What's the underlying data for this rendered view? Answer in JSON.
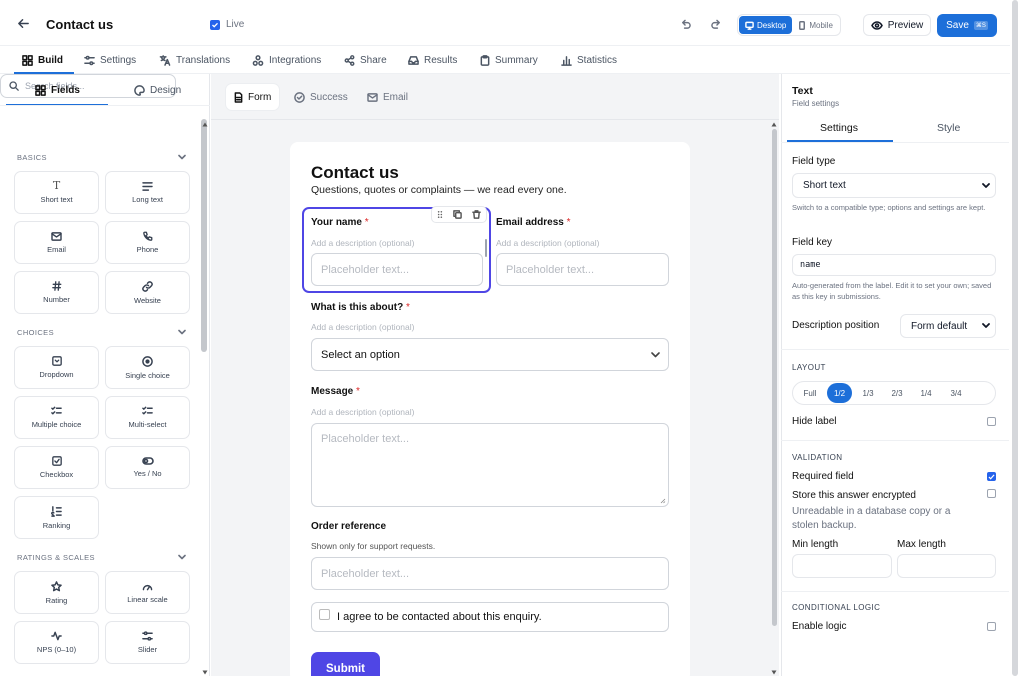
{
  "topbar": {
    "title": "Contact us",
    "live": "Live",
    "devices": [
      "Desktop",
      "Mobile"
    ],
    "preview": "Preview",
    "save": "Save",
    "save_kbd": "⌘S"
  },
  "nav": {
    "items": [
      "Build",
      "Settings",
      "Translations",
      "Integrations",
      "Share",
      "Results",
      "Summary",
      "Statistics"
    ]
  },
  "left": {
    "tabs": [
      "Fields",
      "Design"
    ],
    "search_placeholder": "Search fields...",
    "sections": {
      "basics": "BASICS",
      "choices": "CHOICES",
      "ratings": "RATINGS & SCALES"
    },
    "basics": [
      "Short text",
      "Long text",
      "Email",
      "Phone",
      "Number",
      "Website"
    ],
    "choices": [
      "Dropdown",
      "Single choice",
      "Multiple choice",
      "Multi-select",
      "Checkbox",
      "Yes / No",
      "Ranking"
    ],
    "ratings": [
      "Rating",
      "Linear scale",
      "NPS (0–10)",
      "Slider"
    ]
  },
  "canvas": {
    "tabs": [
      "Form",
      "Success",
      "Email"
    ]
  },
  "form": {
    "title": "Contact us",
    "subtitle": "Questions, quotes or complaints — we read every one.",
    "name_label": "Your name",
    "email_label": "Email address",
    "about_label": "What is this about?",
    "message_label": "Message",
    "order_label": "Order reference",
    "desc_placeholder": "Add a description (optional)",
    "order_desc": "Shown only for support requests.",
    "input_placeholder": "Placeholder text...",
    "select_value": "Select an option",
    "consent": "I agree to be contacted about this enquiry.",
    "submit": "Submit",
    "required_mark": "*"
  },
  "right": {
    "title": "Text",
    "subtitle": "Field settings",
    "tabs": [
      "Settings",
      "Style"
    ],
    "field_type_label": "Field type",
    "field_type_value": "Short text",
    "field_type_help": "Switch to a compatible type; options and settings are kept.",
    "field_key_label": "Field key",
    "field_key_value": "name",
    "field_key_help": "Auto-generated from the label. Edit it to set your own; saved as this key in submissions.",
    "desc_pos_label": "Description position",
    "desc_pos_value": "Form default",
    "layout_section": "LAYOUT",
    "layout_options": [
      "Full",
      "1/2",
      "1/3",
      "2/3",
      "1/4",
      "3/4"
    ],
    "hide_label": "Hide label",
    "validation_section": "VALIDATION",
    "required_label": "Required field",
    "encrypt_label": "Store this answer encrypted",
    "encrypt_help": "Unreadable in a database copy or a stolen backup.",
    "min_label": "Min length",
    "max_label": "Max length",
    "logic_section": "CONDITIONAL LOGIC",
    "logic_label": "Enable logic"
  },
  "colors": {
    "accent": "#1d6fd9",
    "required": "#dc2626",
    "selection": "#4f46e5",
    "submit": "#4f46e5"
  }
}
